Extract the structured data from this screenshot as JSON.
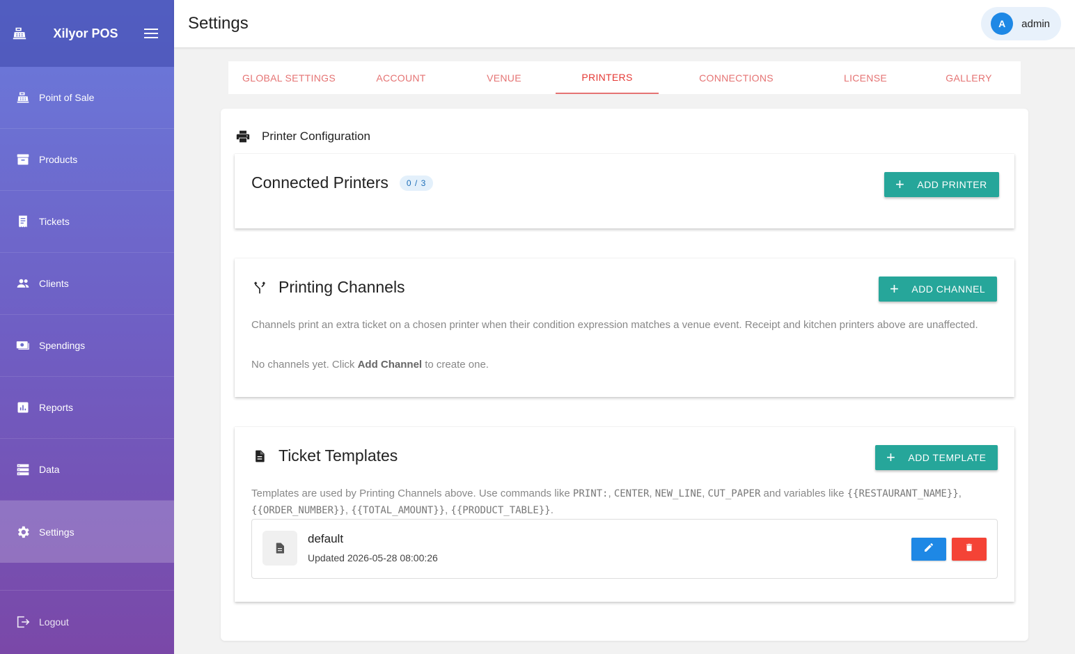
{
  "app": {
    "brand": "Xilyor POS",
    "icons": {
      "logo": "cash-register-icon",
      "menu": "hamburger-menu-icon"
    }
  },
  "sidebar": {
    "items": [
      {
        "label": "Point of Sale",
        "icon": "cash-register-icon",
        "active": false
      },
      {
        "label": "Products",
        "icon": "archive-box-icon",
        "active": false
      },
      {
        "label": "Tickets",
        "icon": "receipt-icon",
        "active": false
      },
      {
        "label": "Clients",
        "icon": "people-icon",
        "active": false
      },
      {
        "label": "Spendings",
        "icon": "money-icon",
        "active": false
      },
      {
        "label": "Reports",
        "icon": "bar-chart-icon",
        "active": false
      },
      {
        "label": "Data",
        "icon": "database-icon",
        "active": false
      },
      {
        "label": "Settings",
        "icon": "gear-icon",
        "active": true
      }
    ],
    "logout": {
      "label": "Logout",
      "icon": "logout-icon"
    }
  },
  "header": {
    "title": "Settings",
    "user": {
      "initial": "A",
      "name": "admin"
    }
  },
  "tabs": [
    {
      "label": "GLOBAL SETTINGS",
      "active": false
    },
    {
      "label": "ACCOUNT",
      "active": false
    },
    {
      "label": "VENUE",
      "active": false
    },
    {
      "label": "PRINTERS",
      "active": true
    },
    {
      "label": "CONNECTIONS",
      "active": false
    },
    {
      "label": "LICENSE",
      "active": false
    },
    {
      "label": "GALLERY",
      "active": false
    }
  ],
  "section": {
    "title": "Printer Configuration",
    "icon": "printer-icon"
  },
  "connected_printers": {
    "title": "Connected Printers",
    "count": "0 / 3",
    "add_label": "ADD PRINTER"
  },
  "printing_channels": {
    "title": "Printing Channels",
    "icon": "fork-icon",
    "add_label": "ADD CHANNEL",
    "description": "Channels print an extra ticket on a chosen printer when their condition expression matches a venue event. Receipt and kitchen printers above are unaffected.",
    "empty_prefix": "No channels yet. Click ",
    "empty_link": "Add Channel",
    "empty_suffix": " to create one."
  },
  "ticket_templates": {
    "title": "Ticket Templates",
    "icon": "document-icon",
    "add_label": "ADD TEMPLATE",
    "help": {
      "t1": "Templates are used by Printing Channels above. Use commands like ",
      "c1": "PRINT:",
      "t2": ", ",
      "c2": "CENTER",
      "t3": ", ",
      "c3": "NEW_LINE",
      "t4": ", ",
      "c4": "CUT_PAPER",
      "t5": " and variables like ",
      "v1": "{{RESTAURANT_NAME}}",
      "t6": ", ",
      "v2": "{{ORDER_NUMBER}}",
      "t7": ", ",
      "v3": "{{TOTAL_AMOUNT}}",
      "t8": ", ",
      "v4": "{{PRODUCT_TABLE}}",
      "t9": "."
    },
    "items": [
      {
        "name": "default",
        "updated": "Updated 2026-05-28 08:00:26"
      }
    ]
  }
}
